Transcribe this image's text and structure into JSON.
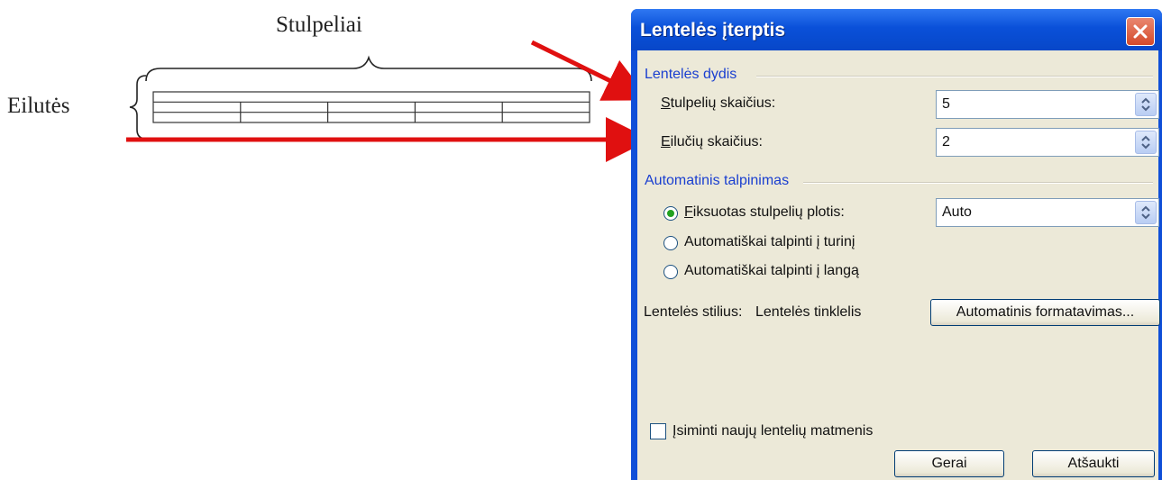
{
  "illustration": {
    "columns_label": "Stulpeliai",
    "rows_label": "Eilutės",
    "table_columns": 5,
    "table_rows": 2,
    "arrow_color": "#e01010"
  },
  "dialog": {
    "title": "Lentelės įterptis",
    "close_icon": "close-icon",
    "size_group": {
      "label": "Lentelės dydis",
      "columns_label": "Stulpelių skaičius:",
      "columns_value": "5",
      "rows_label": "Eilučių skaičius:",
      "rows_value": "2"
    },
    "autofit_group": {
      "label": "Automatinis talpinimas",
      "options": [
        {
          "label": "Fiksuotas stulpelių plotis:",
          "selected": true
        },
        {
          "label": "Automatiškai talpinti į turinį",
          "selected": false
        },
        {
          "label": "Automatiškai talpinti į langą",
          "selected": false
        }
      ],
      "fixed_width_value": "Auto"
    },
    "style_label": "Lentelės stilius:",
    "style_value": "Lentelės tinklelis",
    "autoformat_button": "Automatinis formatavimas...",
    "remember_checkbox": {
      "label": "Įsiminti naujų lentelių matmenis",
      "checked": false
    },
    "ok_button": "Gerai",
    "cancel_button": "Atšaukti",
    "colors": {
      "title_bar": "#0a50d9",
      "group_label": "#1a3fd0",
      "client_bg": "#ece9d8"
    }
  }
}
